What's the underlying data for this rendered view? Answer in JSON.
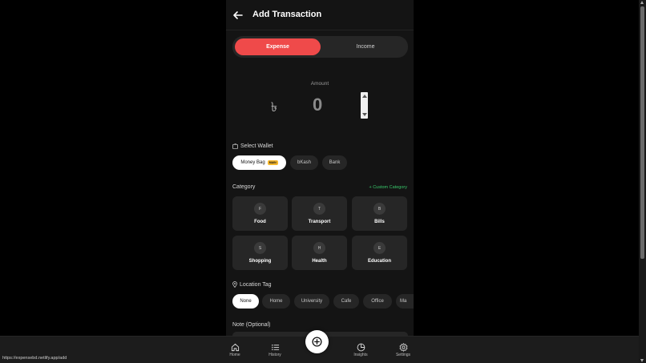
{
  "header": {
    "title": "Add Transaction"
  },
  "segment": {
    "expense": "Expense",
    "income": "Income"
  },
  "amount": {
    "label": "Amount",
    "currency": "৳",
    "value": "0"
  },
  "wallet": {
    "label": "Select Wallet",
    "items": [
      {
        "label": "Money Bag",
        "badge": "MAIN"
      },
      {
        "label": "bKash"
      },
      {
        "label": "Bank"
      }
    ]
  },
  "category": {
    "label": "Category",
    "custom": "+ Custom Category",
    "items": [
      {
        "letter": "F",
        "name": "Food"
      },
      {
        "letter": "T",
        "name": "Transport"
      },
      {
        "letter": "B",
        "name": "Bills"
      },
      {
        "letter": "S",
        "name": "Shopping"
      },
      {
        "letter": "H",
        "name": "Health"
      },
      {
        "letter": "E",
        "name": "Education"
      }
    ]
  },
  "location": {
    "label": "Location Tag",
    "items": [
      "None",
      "Home",
      "University",
      "Cafe",
      "Office",
      "Ma"
    ]
  },
  "note": {
    "label": "Note (Optional)"
  },
  "nav": {
    "home": "Home",
    "history": "History",
    "insights": "Insights",
    "settings": "Settings"
  },
  "status": {
    "url": "https://expensebd.netlify.app/add"
  },
  "colors": {
    "accent": "#ef4a4a",
    "link": "#38c76a",
    "badge": "#f5b82e"
  }
}
